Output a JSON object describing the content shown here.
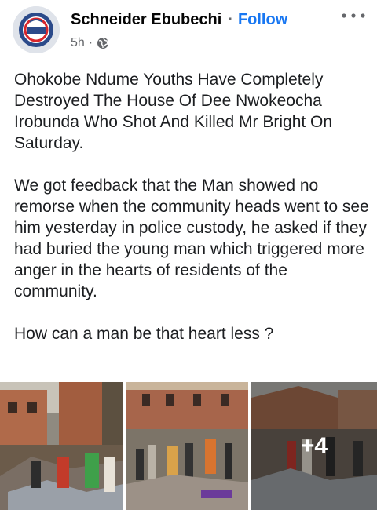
{
  "post": {
    "author": "Schneider Ebubechi",
    "separator": "·",
    "follow_label": "Follow",
    "time": "5h",
    "meta_separator": "·",
    "privacy_icon": "globe-icon",
    "menu_icon": "more-options-icon",
    "paragraphs": [
      "Ohokobe Ndume Youths Have Completely Destroyed The House Of Dee Nwokeocha Irobunda Who Shot And Killed Mr Bright On Saturday.",
      "We got feedback that the Man showed no remorse when the community heads went to see him yesterday in police custody, he asked if they had buried the young man which triggered more anger in the hearts of residents of the community.",
      "How can a man be that heart less ?"
    ]
  },
  "photos": {
    "more_count_label": "+4"
  },
  "colors": {
    "follow": "#1877f2",
    "secondary_text": "#65676b",
    "text": "#1c1e21"
  }
}
